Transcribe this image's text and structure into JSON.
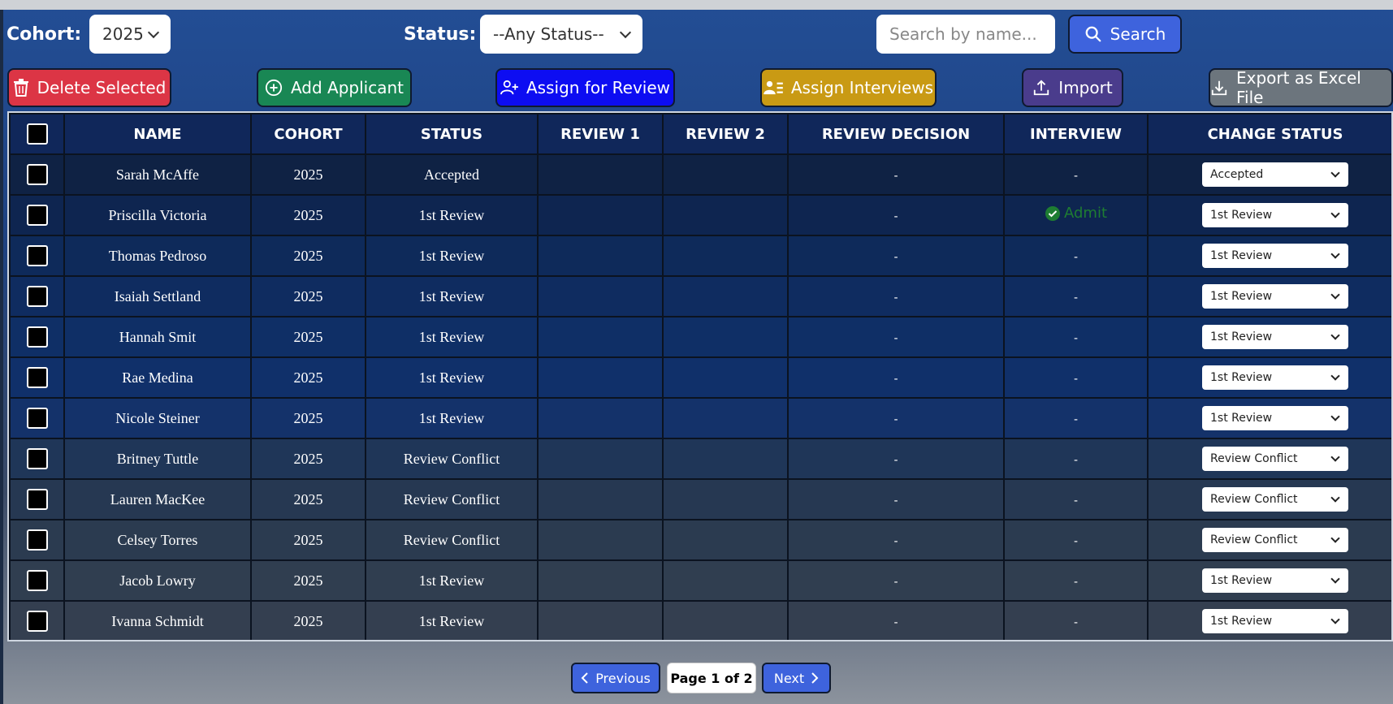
{
  "filters": {
    "cohort_label": "Cohort:",
    "cohort_value": "2025",
    "status_label": "Status:",
    "status_value": "--Any Status--",
    "search_placeholder": "Search by name...",
    "search_button": "Search"
  },
  "actions": {
    "delete": "Delete Selected",
    "add": "Add Applicant",
    "assign_review": "Assign for Review",
    "assign_interviews": "Assign Interviews",
    "import": "Import",
    "export": "Export as Excel File"
  },
  "colors": {
    "delete": "#dc3545",
    "add": "#198754",
    "assign_review": "#0d0df2",
    "assign_interviews": "#c99a14",
    "import": "#4a3c8c",
    "export": "#6c757d",
    "search": "#3e63dd"
  },
  "table": {
    "headers": [
      "NAME",
      "COHORT",
      "STATUS",
      "REVIEW 1",
      "REVIEW 2",
      "REVIEW DECISION",
      "INTERVIEW",
      "CHANGE STATUS"
    ],
    "rows": [
      {
        "name": "Sarah McAffe",
        "cohort": "2025",
        "status": "Accepted",
        "review1": "",
        "review2": "",
        "decision": "-",
        "interview": "-",
        "change": "Accepted"
      },
      {
        "name": "Priscilla Victoria",
        "cohort": "2025",
        "status": "1st Review",
        "review1": "",
        "review2": "",
        "decision": "-",
        "interview": "Admit",
        "change": "1st Review"
      },
      {
        "name": "Thomas Pedroso",
        "cohort": "2025",
        "status": "1st Review",
        "review1": "",
        "review2": "",
        "decision": "-",
        "interview": "-",
        "change": "1st Review"
      },
      {
        "name": "Isaiah Settland",
        "cohort": "2025",
        "status": "1st Review",
        "review1": "",
        "review2": "",
        "decision": "-",
        "interview": "-",
        "change": "1st Review"
      },
      {
        "name": "Hannah Smit",
        "cohort": "2025",
        "status": "1st Review",
        "review1": "",
        "review2": "",
        "decision": "-",
        "interview": "-",
        "change": "1st Review"
      },
      {
        "name": "Rae Medina",
        "cohort": "2025",
        "status": "1st Review",
        "review1": "",
        "review2": "",
        "decision": "-",
        "interview": "-",
        "change": "1st Review"
      },
      {
        "name": "Nicole Steiner",
        "cohort": "2025",
        "status": "1st Review",
        "review1": "",
        "review2": "",
        "decision": "-",
        "interview": "-",
        "change": "1st Review"
      },
      {
        "name": "Britney Tuttle",
        "cohort": "2025",
        "status": "Review Conflict",
        "review1": "",
        "review2": "",
        "decision": "-",
        "interview": "-",
        "change": "Review Conflict"
      },
      {
        "name": "Lauren MacKee",
        "cohort": "2025",
        "status": "Review Conflict",
        "review1": "",
        "review2": "",
        "decision": "-",
        "interview": "-",
        "change": "Review Conflict"
      },
      {
        "name": "Celsey Torres",
        "cohort": "2025",
        "status": "Review Conflict",
        "review1": "",
        "review2": "",
        "decision": "-",
        "interview": "-",
        "change": "Review Conflict"
      },
      {
        "name": "Jacob Lowry",
        "cohort": "2025",
        "status": "1st Review",
        "review1": "",
        "review2": "",
        "decision": "-",
        "interview": "-",
        "change": "1st Review"
      },
      {
        "name": "Ivanna Schmidt",
        "cohort": "2025",
        "status": "1st Review",
        "review1": "",
        "review2": "",
        "decision": "-",
        "interview": "-",
        "change": "1st Review"
      }
    ]
  },
  "pagination": {
    "previous": "Previous",
    "indicator": "Page 1 of 2",
    "next": "Next"
  }
}
